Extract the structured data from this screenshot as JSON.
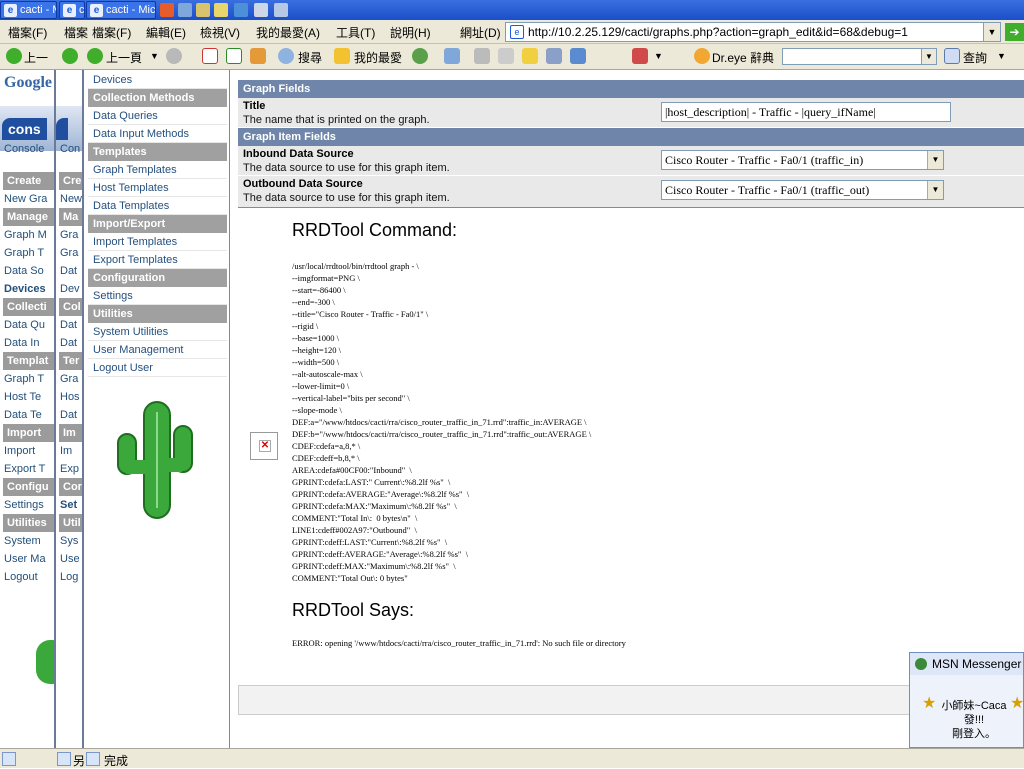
{
  "taskbar": {
    "buttons": [
      "cacti - M",
      "ca",
      "cacti - Micr"
    ],
    "quick_launch": [
      "firefox-icon",
      "folder-icon",
      "messenger-icon",
      "paint-icon",
      "notes-icon",
      "media-icon"
    ]
  },
  "menubar": {
    "items": [
      "檔案(F)",
      "檔案",
      "檔案(F)",
      "編輯(E)",
      "檢視(V)",
      "我的最愛(A)",
      "工具(T)",
      "說明(H)"
    ],
    "address_label": "網址(D)",
    "address_value": "http://10.2.25.129/cacti/graphs.php?action=graph_edit&id=68&debug=1"
  },
  "toolbar": {
    "back_label": "上一頁",
    "back_label_short": "上一",
    "search_label": "搜尋",
    "favorites_label": "我的最愛",
    "dreye_label": "Dr.eye 辭典",
    "query_label": "查詢"
  },
  "ghost_windows": {
    "logo": "Google",
    "banner": "cons",
    "tab": "Console",
    "items": [
      "Create",
      "New Gra",
      "Manage",
      "Graph M",
      "Graph T",
      "Data So",
      "Devices",
      "Collecti",
      "Data Qu",
      "Data In",
      "Templat",
      "Graph T",
      "Host Te",
      "Data Te",
      "Import",
      "Import",
      "Export T",
      "Configu",
      "Settings",
      "Utilities",
      "System",
      "User Ma",
      "Logout"
    ]
  },
  "sidebar": {
    "items": [
      {
        "label": "Devices",
        "type": "link"
      },
      {
        "label": "Collection Methods",
        "type": "header"
      },
      {
        "label": "Data Queries",
        "type": "link"
      },
      {
        "label": "Data Input Methods",
        "type": "link"
      },
      {
        "label": "Templates",
        "type": "header"
      },
      {
        "label": "Graph Templates",
        "type": "link"
      },
      {
        "label": "Host Templates",
        "type": "link"
      },
      {
        "label": "Data Templates",
        "type": "link"
      },
      {
        "label": "Import/Export",
        "type": "header"
      },
      {
        "label": "Import Templates",
        "type": "link"
      },
      {
        "label": "Export Templates",
        "type": "link"
      },
      {
        "label": "Configuration",
        "type": "header"
      },
      {
        "label": "Settings",
        "type": "link"
      },
      {
        "label": "Utilities",
        "type": "header"
      },
      {
        "label": "System Utilities",
        "type": "link"
      },
      {
        "label": "User Management",
        "type": "link"
      },
      {
        "label": "Logout User",
        "type": "link"
      }
    ]
  },
  "content": {
    "graph_fields_header": "Graph Fields",
    "title_label": "Title",
    "title_desc": "The name that is printed on the graph.",
    "title_value": "|host_description| - Traffic - |query_ifName|",
    "graph_item_fields_header": "Graph Item Fields",
    "inbound_label": "Inbound Data Source",
    "inbound_desc": "The data source to use for this graph item.",
    "inbound_value": "Cisco Router - Traffic - Fa0/1 (traffic_in)",
    "outbound_label": "Outbound Data Source",
    "outbound_desc": "The data source to use for this graph item.",
    "outbound_value": "Cisco Router - Traffic - Fa0/1 (traffic_out)",
    "rrd_command_title": "RRDTool Command:",
    "rrd_command": "/usr/local/rrdtool/bin/rrdtool graph - \\\n--imgformat=PNG \\\n--start=-86400 \\\n--end=-300 \\\n--title=\"Cisco Router - Traffic - Fa0/1\" \\\n--rigid \\\n--base=1000 \\\n--height=120 \\\n--width=500 \\\n--alt-autoscale-max \\\n--lower-limit=0 \\\n--vertical-label=\"bits per second\" \\\n--slope-mode \\\nDEF:a=\"/www/htdocs/cacti/rra/cisco_router_traffic_in_71.rrd\":traffic_in:AVERAGE \\\nDEF:b=\"/www/htdocs/cacti/rra/cisco_router_traffic_in_71.rrd\":traffic_out:AVERAGE \\\nCDEF:cdefa=a,8,* \\\nCDEF:cdeff=b,8,* \\\nAREA:cdefa#00CF00:\"Inbound\"  \\\nGPRINT:cdefa:LAST:\" Current\\:%8.2lf %s\"  \\\nGPRINT:cdefa:AVERAGE:\"Average\\:%8.2lf %s\"  \\\nGPRINT:cdefa:MAX:\"Maximum\\:%8.2lf %s\"  \\\nCOMMENT:\"Total In\\:  0 bytes\\n\"  \\\nLINE1:cdeff#002A97:\"Outbound\"  \\\nGPRINT:cdeff:LAST:\"Current\\:%8.2lf %s\"  \\\nGPRINT:cdeff:AVERAGE:\"Average\\:%8.2lf %s\"  \\\nGPRINT:cdeff:MAX:\"Maximum\\:%8.2lf %s\"  \\\nCOMMENT:\"Total Out\\: 0 bytes\"",
    "rrd_says_title": "RRDTool Says:",
    "rrd_says": "ERROR: opening '/www/htdocs/cacti/rra/cisco_router_traffic_in_71.rrd': No such file or directory"
  },
  "msn": {
    "title": "MSN Messenger",
    "line1": "小師妹~Caca",
    "line2": "發!!!",
    "line3": "剛登入。"
  },
  "status": {
    "done_text": "完成",
    "partial": "另"
  },
  "colors": {
    "header_band": "#6f86aa",
    "nav_header": "#a0a0a0",
    "cactus": "#3aa83a"
  }
}
